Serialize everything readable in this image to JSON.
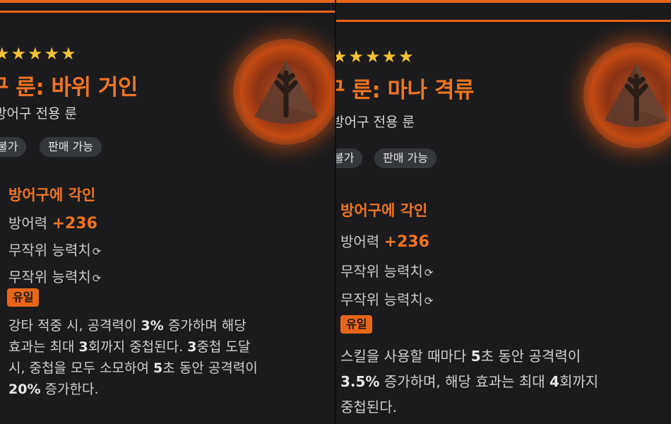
{
  "colors": {
    "accent": "#e8661a",
    "star": "#f5c233",
    "background": "#1b1b1d",
    "tag_bg": "#34373c"
  },
  "cards": [
    {
      "stars": "★★★★★",
      "title": "구 룬: 바위 거인",
      "subtitle": "방어구 전용 룬",
      "tags": [
        "불가",
        "판매 가능"
      ],
      "icon": "rune-stone-icon",
      "section_title": "방어구에 각인",
      "defense_label": "방어력",
      "defense_value": "+236",
      "random_stat_1": "무작위 능력치",
      "random_stat_2": "무작위 능력치",
      "refresh_icon": "refresh-icon",
      "rarity_badge": "유일",
      "description_lines": [
        [
          "강타 적중 시, 공격력이 ",
          "3%",
          " 증가하며 해당"
        ],
        [
          "효과는 최대 ",
          "3",
          "회까지 중첩된다. ",
          "3",
          "중첩 도달"
        ],
        [
          "시, 중첩을 모두 소모하여 ",
          "5",
          "초 동안 공격력이"
        ],
        [
          "",
          "20%",
          " 증가한다."
        ]
      ]
    },
    {
      "stars": "★★★★★",
      "title": "구 룬: 마나 격류",
      "subtitle": "방어구 전용 룬",
      "tags": [
        "불가",
        "판매 가능"
      ],
      "icon": "rune-stone-icon",
      "section_title": "방어구에 각인",
      "defense_label": "방어력",
      "defense_value": "+236",
      "random_stat_1": "무작위 능력치",
      "random_stat_2": "무작위 능력치",
      "refresh_icon": "refresh-icon",
      "rarity_badge": "유일",
      "description_lines": [
        [
          "스킬을 사용할 때마다 ",
          "5",
          "초 동안 공격력이"
        ],
        [
          "",
          "3.5%",
          " 증가하며, 해당 효과는 최대 ",
          "4",
          "회까지"
        ],
        [
          "중첩된다."
        ]
      ]
    }
  ]
}
